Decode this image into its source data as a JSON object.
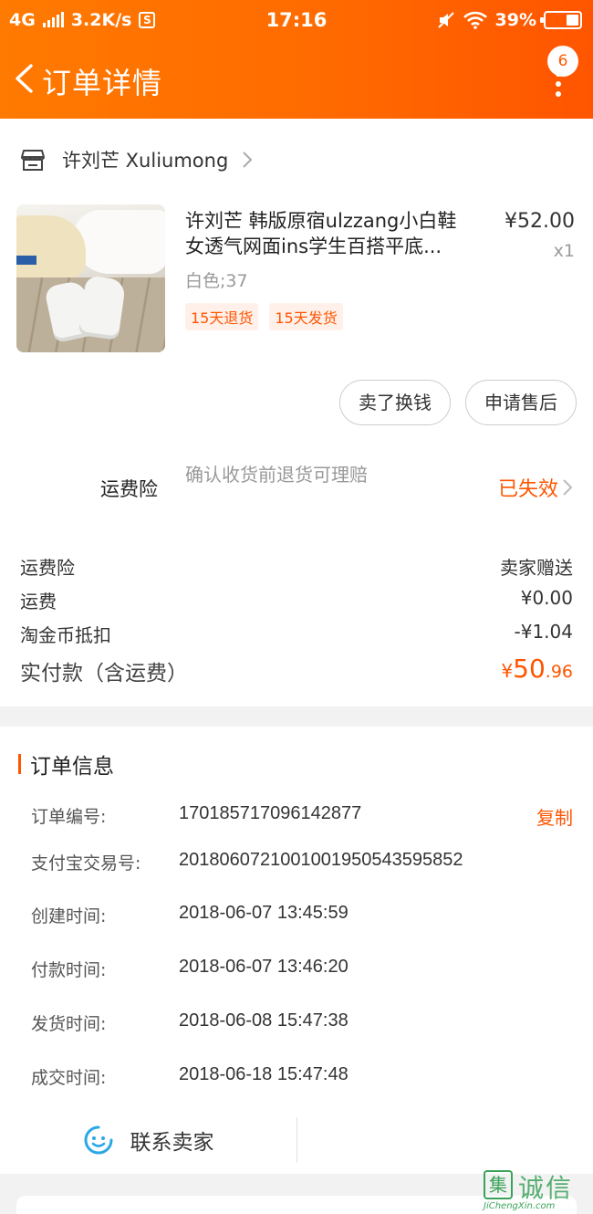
{
  "status_bar": {
    "network": "4G",
    "speed": "3.2K/s",
    "sim_icon": "S",
    "time": "17:16",
    "battery": "39%",
    "battery_level": 0.39
  },
  "nav": {
    "title": "订单详情",
    "badge_count": "6"
  },
  "shop": {
    "name": "许刘芒 Xuliumong"
  },
  "product": {
    "title_line1": "许刘芒 韩版原宿ulzzang小白鞋",
    "title_line2": "女透气网面ins学生百搭平底...",
    "price": "¥52.00",
    "quantity": "x1",
    "sku": "白色;37",
    "tags": [
      "15天退货",
      "15天发货"
    ]
  },
  "actions": {
    "sell_label": "卖了换钱",
    "aftersale_label": "申请售后"
  },
  "insurance": {
    "label": "运费险",
    "description": "确认收货前退货可理赔",
    "status": "已失效"
  },
  "fees": [
    {
      "label": "运费险",
      "value": "卖家赠送"
    },
    {
      "label": "运费",
      "value": "¥0.00"
    },
    {
      "label": "淘金币抵扣",
      "value": "-¥1.04"
    }
  ],
  "total": {
    "label": "实付款（含运费）",
    "currency": "¥",
    "integer": "50",
    "decimal": ".96"
  },
  "order_info": {
    "title": "订单信息",
    "copy_label": "复制",
    "rows": [
      {
        "label": "订单编号:",
        "value": "170185717096142877"
      },
      {
        "label": "支付宝交易号:",
        "value": "2018060721001001950543595852"
      },
      {
        "label": "创建时间:",
        "value": "2018-06-07 13:45:59"
      },
      {
        "label": "付款时间:",
        "value": "2018-06-07 13:46:20"
      },
      {
        "label": "发货时间:",
        "value": "2018-06-08 15:47:38"
      },
      {
        "label": "成交时间:",
        "value": "2018-06-18 15:47:48"
      }
    ]
  },
  "contact": {
    "label": "联系卖家"
  },
  "watermark": {
    "logo_char": "集",
    "name": "诚信",
    "url": "JiChengXin.com"
  },
  "colors": {
    "brand": "#ff5500",
    "header_start": "#ff7a00",
    "contact_icon": "#2aa7e6",
    "watermark": "#3aa35a"
  }
}
